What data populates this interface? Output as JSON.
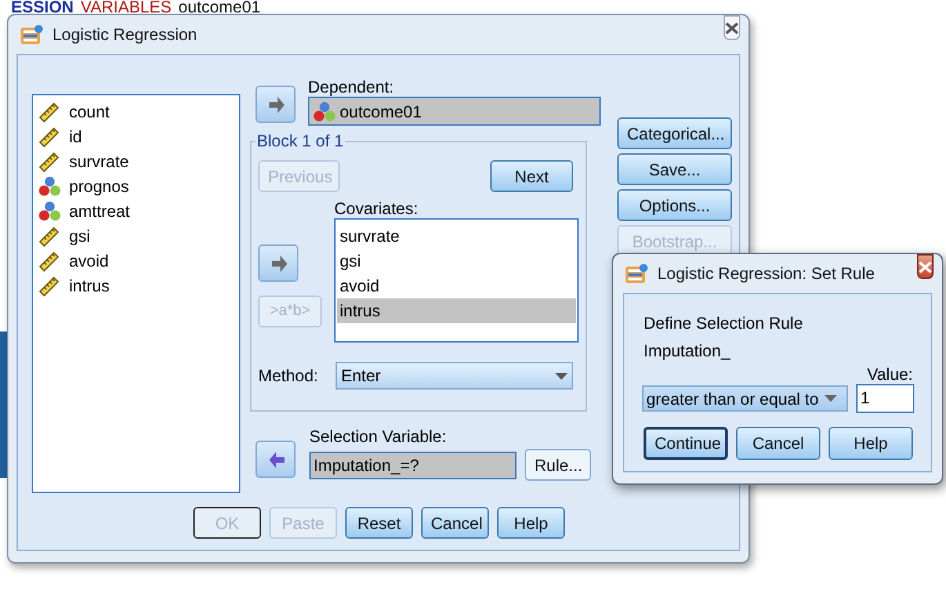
{
  "editor_line": [
    {
      "text": "ESSION",
      "kind": "keyword"
    },
    {
      "text": "VARIABLES",
      "kind": "subcommand"
    },
    {
      "text": "outcome01",
      "kind": "plain"
    }
  ],
  "main_dialog": {
    "title": "Logistic Regression",
    "variables": [
      {
        "name": "count",
        "kind": "scale"
      },
      {
        "name": "id",
        "kind": "scale"
      },
      {
        "name": "survrate",
        "kind": "scale"
      },
      {
        "name": "prognos",
        "kind": "nominal"
      },
      {
        "name": "amttreat",
        "kind": "nominal"
      },
      {
        "name": "gsi",
        "kind": "scale"
      },
      {
        "name": "avoid",
        "kind": "scale"
      },
      {
        "name": "intrus",
        "kind": "scale"
      }
    ],
    "dependent": {
      "label": "Dependent:",
      "value": "outcome01",
      "kind": "nominal"
    },
    "block": {
      "label": "Block 1 of 1",
      "previous": {
        "label": "Previous",
        "disabled": true
      },
      "next": {
        "label": "Next",
        "disabled": false
      }
    },
    "covariates": {
      "label": "Covariates:",
      "items": [
        {
          "name": "survrate",
          "selected": false
        },
        {
          "name": "gsi",
          "selected": false
        },
        {
          "name": "avoid",
          "selected": false
        },
        {
          "name": "intrus",
          "selected": true
        }
      ]
    },
    "interaction_button": {
      "label": ">a*b>",
      "disabled": true
    },
    "method": {
      "label": "Method:",
      "value": "Enter"
    },
    "selection_variable": {
      "label": "Selection Variable:",
      "value": "Imputation_=?"
    },
    "rule_button": {
      "label": "Rule...",
      "disabled": false
    },
    "side_buttons": [
      {
        "label": "Categorical...",
        "disabled": false
      },
      {
        "label": "Save...",
        "disabled": false
      },
      {
        "label": "Options...",
        "disabled": false
      },
      {
        "label": "Bootstrap...",
        "disabled": true
      }
    ],
    "buttons": [
      {
        "label": "OK",
        "disabled": true
      },
      {
        "label": "Paste",
        "disabled": true
      },
      {
        "label": "Reset",
        "disabled": false
      },
      {
        "label": "Cancel",
        "disabled": false
      },
      {
        "label": "Help",
        "disabled": false
      }
    ]
  },
  "rule_dialog": {
    "title": "Logistic Regression: Set Rule",
    "heading": "Define Selection Rule",
    "variable": "Imputation_",
    "value_label": "Value:",
    "operator": "greater than or equal to",
    "value": "1",
    "buttons": [
      {
        "label": "Continue",
        "default": true
      },
      {
        "label": "Cancel",
        "default": false
      },
      {
        "label": "Help",
        "default": false
      }
    ]
  }
}
